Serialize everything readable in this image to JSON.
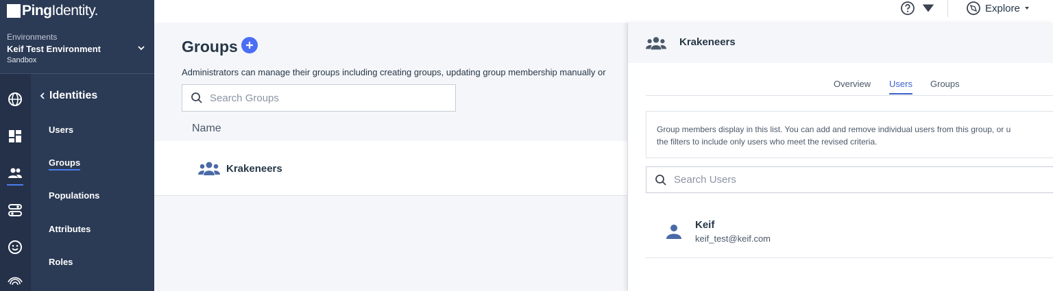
{
  "brand": {
    "logo_bold": "Ping",
    "logo_light": "Identity."
  },
  "environment": {
    "label": "Environments",
    "name": "Keif Test Environment",
    "type": "Sandbox"
  },
  "nav": {
    "section_title": "Identities",
    "items": [
      {
        "label": "Users"
      },
      {
        "label": "Groups",
        "active": true
      },
      {
        "label": "Populations"
      },
      {
        "label": "Attributes"
      },
      {
        "label": "Roles"
      }
    ],
    "rail_icons": [
      "globe-icon",
      "dashboard-icon",
      "identities-icon",
      "connections-icon",
      "experiences-icon",
      "fingerprint-icon"
    ]
  },
  "topbar": {
    "explore_label": "Explore"
  },
  "main": {
    "title": "Groups",
    "description": "Administrators can manage their groups including creating groups, updating group membership manually or",
    "search_placeholder": "Search Groups",
    "column_header": "Name",
    "groups": [
      {
        "name": "Krakeneers"
      }
    ]
  },
  "panel": {
    "title": "Krakeneers",
    "tabs": [
      {
        "label": "Overview"
      },
      {
        "label": "Users",
        "active": true
      },
      {
        "label": "Groups"
      }
    ],
    "info_line1": "Group members display in this list. You can add and remove individual users from this group, or u",
    "info_line2": "the filters to include only users who meet the revised criteria.",
    "search_placeholder": "Search Users",
    "users": [
      {
        "name": "Keif",
        "email": "keif_test@keif.com"
      }
    ]
  },
  "colors": {
    "sidebar": "#2b3a55",
    "rail": "#243149",
    "accent": "#4c6ef5",
    "tab_active": "#3a5fcd"
  }
}
